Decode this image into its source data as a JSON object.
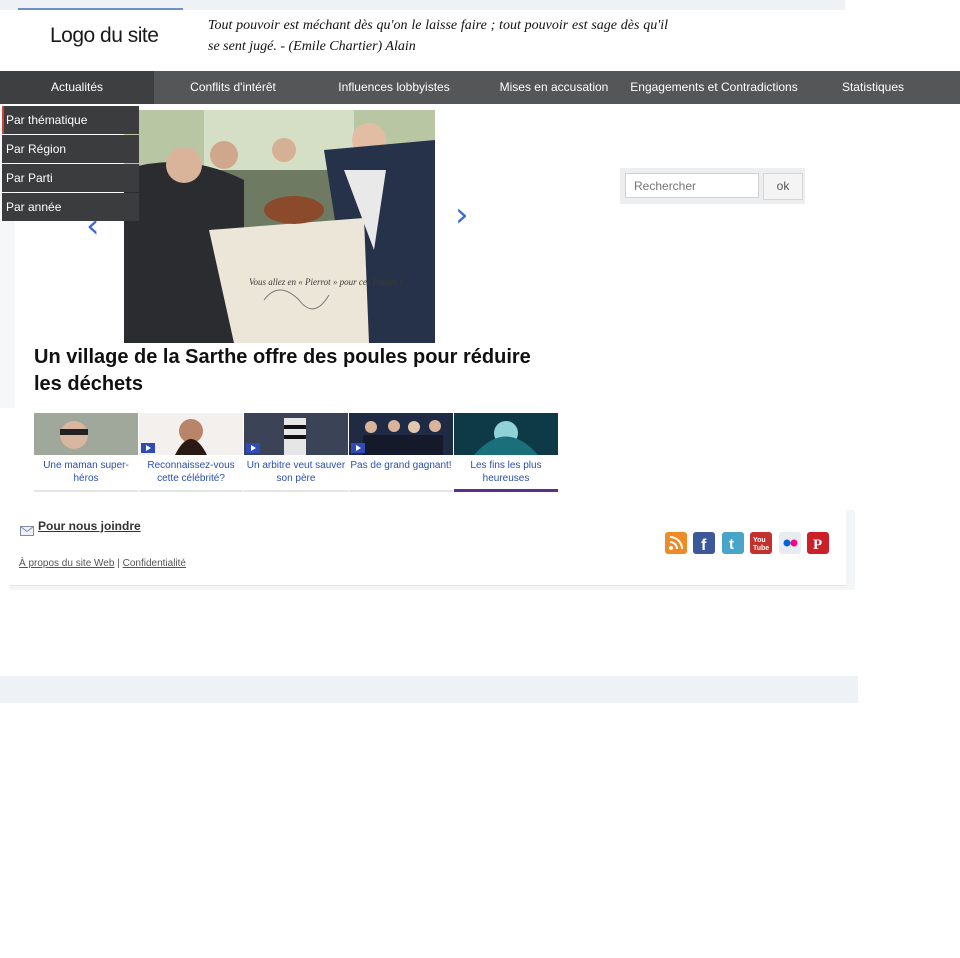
{
  "header": {
    "logo": "Logo du site",
    "quote": "Tout pouvoir est méchant dès qu'on le laisse faire ; tout pouvoir est sage dès qu'il se sent jugé. - (Emile Chartier) Alain"
  },
  "nav": {
    "items": [
      "Actualités",
      "Conflits d'intérêt",
      "Influences lobbyistes",
      "Mises en accusation",
      "Engagements et Contradictions",
      "Statistiques"
    ]
  },
  "dropdown": {
    "items": [
      "Par thématique",
      "Par Région",
      "Par Parti",
      "Par année"
    ]
  },
  "search": {
    "placeholder": "Rechercher",
    "button": "ok"
  },
  "hero": {
    "title": "Un village de la Sarthe offre des poules pour réduire les déchets",
    "box_text": "Vous allez en « Pierrot » pour ces Poules !"
  },
  "thumbnails": [
    {
      "caption": "Une maman super-héros"
    },
    {
      "caption": "Reconnaissez-vous cette célébrité?"
    },
    {
      "caption": "Un arbitre veut sauver son père"
    },
    {
      "caption": "Pas de grand gagnant!"
    },
    {
      "caption": "Les fins les plus heureuses"
    }
  ],
  "footer": {
    "contact": "Pour nous joindre",
    "about": "À propos du site Web",
    "privacy": "Confidentialité",
    "separator": "|",
    "social": [
      "rss-icon",
      "facebook-icon",
      "twitter-icon",
      "youtube-icon",
      "flickr-icon",
      "pinterest-icon"
    ]
  },
  "colors": {
    "nav_bg": "#555658",
    "dropdown_bg": "#3b3c3e",
    "link": "#2b4fae",
    "accent": "#d0413a"
  }
}
